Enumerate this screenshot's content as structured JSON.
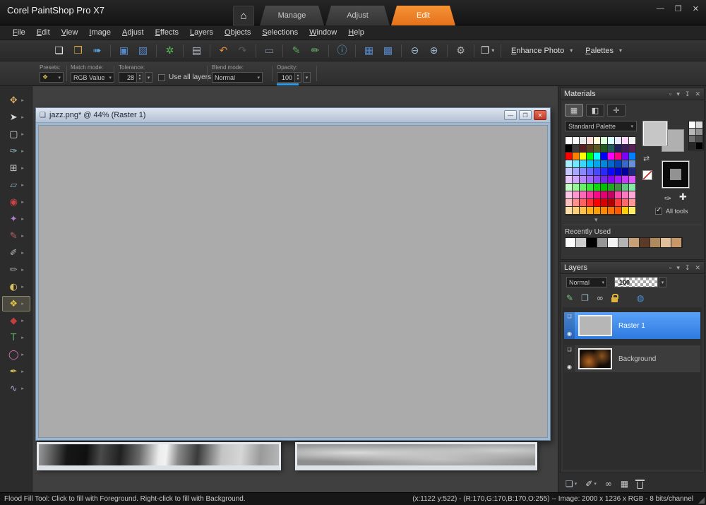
{
  "titlebar": {
    "app_title": "Corel PaintShop Pro X7",
    "tabs": [
      {
        "label": "Manage",
        "active": false
      },
      {
        "label": "Adjust",
        "active": false
      },
      {
        "label": "Edit",
        "active": true
      }
    ],
    "home_icon": "⌂",
    "window_controls": {
      "minimize": "—",
      "maximize": "❒",
      "close": "✕"
    }
  },
  "menubar": {
    "items": [
      "File",
      "Edit",
      "View",
      "Image",
      "Adjust",
      "Effects",
      "Layers",
      "Objects",
      "Selections",
      "Window",
      "Help"
    ]
  },
  "toolbar": {
    "buttons": [
      {
        "name": "new-document-icon",
        "glyph": "❏",
        "color": "#e2e6ea"
      },
      {
        "name": "open-image-icon",
        "glyph": "❒",
        "color": "#d9a43c"
      },
      {
        "name": "acquire-icon",
        "glyph": "➠",
        "color": "#5aa0d8"
      },
      {
        "sep": true
      },
      {
        "name": "save-icon",
        "glyph": "▣",
        "color": "#5588c8"
      },
      {
        "name": "save-as-icon",
        "glyph": "▨",
        "color": "#5588c8"
      },
      {
        "sep": true
      },
      {
        "name": "share-icon",
        "glyph": "✲",
        "color": "#5bb85b"
      },
      {
        "sep": true
      },
      {
        "name": "print-icon",
        "glyph": "▤",
        "color": "#b4bcc4"
      },
      {
        "sep": true
      },
      {
        "name": "undo-icon",
        "glyph": "↶",
        "color": "#e8913a"
      },
      {
        "name": "redo-icon",
        "glyph": "↷",
        "color": "#8a8a8a",
        "disabled": true
      },
      {
        "sep": true
      },
      {
        "name": "capture-icon",
        "glyph": "▭",
        "color": "#7a8798"
      },
      {
        "sep": true
      },
      {
        "name": "review-brush-icon",
        "glyph": "✎",
        "color": "#58a858"
      },
      {
        "name": "batch-brush-icon",
        "glyph": "✏",
        "color": "#6ab86a"
      },
      {
        "sep": true
      },
      {
        "name": "image-info-icon",
        "glyph": "ⓘ",
        "color": "#5aa0d8"
      },
      {
        "sep": true
      },
      {
        "name": "histogram-icon",
        "glyph": "▦",
        "color": "#5588c8"
      },
      {
        "name": "overview-icon",
        "glyph": "▩",
        "color": "#5588c8"
      },
      {
        "sep": true
      },
      {
        "name": "zoom-out-icon",
        "glyph": "⊖",
        "color": "#9ab4cc"
      },
      {
        "name": "zoom-in-icon",
        "glyph": "⊕",
        "color": "#9ab4cc"
      },
      {
        "sep": true
      },
      {
        "name": "preferences-icon",
        "glyph": "⚙",
        "color": "#b0b0b0"
      },
      {
        "sep": true
      },
      {
        "name": "copy-special-icon",
        "glyph": "❐",
        "color": "#d8d8d8",
        "dropdown": true
      },
      {
        "sep": true
      }
    ],
    "enhance_photo_label": "Enhance Photo",
    "palettes_label": "Palettes",
    "dropdown_arrow": "▾"
  },
  "tool_options": {
    "presets_label": "Presets:",
    "presets_glyph": "❖",
    "match_mode_label": "Match mode:",
    "match_mode_value": "RGB Value",
    "tolerance_label": "Tolerance:",
    "tolerance_value": "28",
    "use_all_layers_label": "Use all layers",
    "use_all_layers_checked": false,
    "blend_mode_label": "Blend mode:",
    "blend_mode_value": "Normal",
    "opacity_label": "Opacity:",
    "opacity_value": "100"
  },
  "tools_palette": {
    "tools": [
      {
        "name": "pan-tool",
        "glyph": "✥",
        "color": "#d4a96a"
      },
      {
        "name": "pick-tool",
        "glyph": "➤",
        "color": "#d8d8d8"
      },
      {
        "name": "selection-tool",
        "glyph": "▢",
        "color": "#d0d0d0"
      },
      {
        "name": "dropper-tool",
        "glyph": "✑",
        "color": "#8fb8cc"
      },
      {
        "name": "crop-tool",
        "glyph": "⊞",
        "color": "#c8c8c8"
      },
      {
        "name": "straighten-tool",
        "glyph": "▱",
        "color": "#8aa8b8"
      },
      {
        "name": "red-eye-tool",
        "glyph": "◉",
        "color": "#cc4444"
      },
      {
        "name": "makeover-tool",
        "glyph": "✦",
        "color": "#b080d0"
      },
      {
        "name": "clone-brush-tool",
        "glyph": "✎",
        "color": "#c06060"
      },
      {
        "name": "paint-brush-tool",
        "glyph": "✐",
        "color": "#b8b8b8"
      },
      {
        "name": "airbrush-tool",
        "glyph": "✏",
        "color": "#989898"
      },
      {
        "name": "lighten-darken-tool",
        "glyph": "◐",
        "color": "#d8c060"
      },
      {
        "name": "flood-fill-tool",
        "glyph": "❖",
        "color": "#e0c040",
        "selected": true
      },
      {
        "name": "color-changer-tool",
        "glyph": "◆",
        "color": "#c04040"
      },
      {
        "name": "text-tool",
        "glyph": "T",
        "color": "#58a858"
      },
      {
        "name": "preset-shape-tool",
        "glyph": "◯",
        "color": "#d878c0"
      },
      {
        "name": "pen-tool",
        "glyph": "✒",
        "color": "#d0b850"
      },
      {
        "name": "warp-brush-tool",
        "glyph": "∿",
        "color": "#b0a0d0"
      }
    ]
  },
  "document_window": {
    "title": "jazz.png* @ 44% (Raster 1)",
    "icon": "❏",
    "controls": {
      "minimize": "—",
      "restore": "❐",
      "close": "✕"
    }
  },
  "materials_panel": {
    "title": "Materials",
    "header_controls": {
      "frame": "▫",
      "menu": "▾",
      "pin": "↧",
      "close": "✕"
    },
    "view_buttons": [
      {
        "name": "frame-view-button",
        "glyph": "▦",
        "active": true
      },
      {
        "name": "rainbow-view-button",
        "glyph": "◧",
        "active": false
      },
      {
        "name": "swatches-view-button",
        "glyph": "✛",
        "active": false
      }
    ],
    "palette_selector": "Standard Palette",
    "palette_rows": [
      [
        "#ffffff",
        "#fcfcfc",
        "#e8e8e8",
        "#ffdede",
        "#ffffd8",
        "#d8ffd8",
        "#d8ffff",
        "#e8e8ff",
        "#ffd8ff",
        "#f4f4f4"
      ],
      [
        "#000000",
        "#3c3c3c",
        "#5a1e1e",
        "#5a3c1e",
        "#5a5a1e",
        "#1e5a1e",
        "#1e5a5a",
        "#1e1e5a",
        "#3c1e5a",
        "#5a1e5a"
      ],
      [
        "#ff0000",
        "#ff8000",
        "#ffff00",
        "#00ff00",
        "#00ffff",
        "#0000ff",
        "#ff00ff",
        "#ff0080",
        "#8000ff",
        "#0080ff"
      ],
      [
        "#a8f0ff",
        "#70e8ff",
        "#38d8ff",
        "#00c8ff",
        "#00a8f0",
        "#0088e0",
        "#0068d0",
        "#0048c0",
        "#3868c8",
        "#6890d8"
      ],
      [
        "#c8c8ff",
        "#a8a8ff",
        "#8888ff",
        "#6868ff",
        "#4848ff",
        "#2828ff",
        "#0808ff",
        "#0000d0",
        "#0000a0",
        "#202880"
      ],
      [
        "#e8c8ff",
        "#d0a8ff",
        "#b888ff",
        "#a068ff",
        "#8848ff",
        "#7028f0",
        "#8800ff",
        "#a818ff",
        "#c838ff",
        "#e058ff"
      ],
      [
        "#c8ffc8",
        "#98f898",
        "#68f068",
        "#38e838",
        "#10d810",
        "#00c000",
        "#20a820",
        "#409040",
        "#60c880",
        "#88e8a8"
      ],
      [
        "#ffc8e8",
        "#ff98d0",
        "#ff68b8",
        "#ff38a0",
        "#ff0888",
        "#e80070",
        "#c80060",
        "#ff48a8",
        "#ff78c0",
        "#ffa8d8"
      ],
      [
        "#ffc0c0",
        "#ff9090",
        "#ff6060",
        "#ff3030",
        "#ff0000",
        "#d80000",
        "#b00000",
        "#ff3838",
        "#ff6868",
        "#ff9898"
      ],
      [
        "#ffe0a8",
        "#ffd078",
        "#ffc048",
        "#ffb018",
        "#ffa000",
        "#ff8800",
        "#ff7000",
        "#ff5800",
        "#ffcc00",
        "#ffee66"
      ]
    ],
    "gray_steps": [
      "#ffffff",
      "#dbdbdb",
      "#b7b7b7",
      "#939393",
      "#6f6f6f",
      "#4b4b4b",
      "#272727",
      "#000000"
    ],
    "foreground_color": "#c6c6c6",
    "background_color": "#b0b0b0",
    "swap_icon": "⇄",
    "dropper_icon": "✑",
    "add_color_icon": "✚",
    "all_tools_label": "All tools",
    "all_tools_checked": true,
    "expander_icon": "▾",
    "recently_used_label": "Recently Used",
    "recently_used": [
      "#ffffff",
      "#cccccc",
      "#000000",
      "#969696",
      "#f2f2f2",
      "#b4b4b4",
      "#c8a078",
      "#5c3a28",
      "#b08a5a",
      "#e0c09a",
      "#c89868"
    ]
  },
  "layers_panel": {
    "title": "Layers",
    "header_controls": {
      "frame": "▫",
      "menu": "▾",
      "pin": "↧",
      "close": "✕"
    },
    "blend_mode": "Normal",
    "opacity": "100",
    "toolbar": [
      {
        "name": "edit-selectivity-icon",
        "glyph": "✎",
        "color": "#7cc47c"
      },
      {
        "name": "duplicate-layer-icon",
        "glyph": "❐",
        "color": "#9ab4c4"
      },
      {
        "name": "link-layers-icon",
        "glyph": "∞",
        "color": "#c8c8c8"
      },
      {
        "name": "lock-transparency-icon",
        "css": "padlock"
      },
      {
        "name": "web-layer-icon",
        "glyph": "◍",
        "color": "#4a90d8",
        "gap": true
      }
    ],
    "layers": [
      {
        "name": "Raster 1",
        "selected": true
      },
      {
        "name": "Background",
        "selected": false
      }
    ],
    "bottom_toolbar": [
      {
        "name": "new-layer-icon",
        "glyph": "❏",
        "color": "#b8c4d0",
        "dropdown": true
      },
      {
        "name": "new-mask-icon",
        "glyph": "✐",
        "color": "#d8d8d8",
        "dropdown": true
      },
      {
        "name": "link-toggle-icon",
        "glyph": "∞",
        "color": "#c8c8c8"
      },
      {
        "name": "merge-icon",
        "glyph": "▦",
        "color": "#c8c8c8"
      },
      {
        "name": "delete-layer-icon",
        "css": "trash"
      }
    ]
  },
  "statusbar": {
    "tool_hint": "Flood Fill Tool: Click to fill with Foreground. Right-click to fill with Background.",
    "info": "(x:1122 y:522) - (R:170,G:170,B:170,O:255) -- Image:  2000 x 1236 x RGB - 8 bits/channel"
  },
  "colors": {
    "accent_orange": "#ee7c1e",
    "selection_blue": "#3486f0",
    "canvas_gray": "#ababab"
  }
}
